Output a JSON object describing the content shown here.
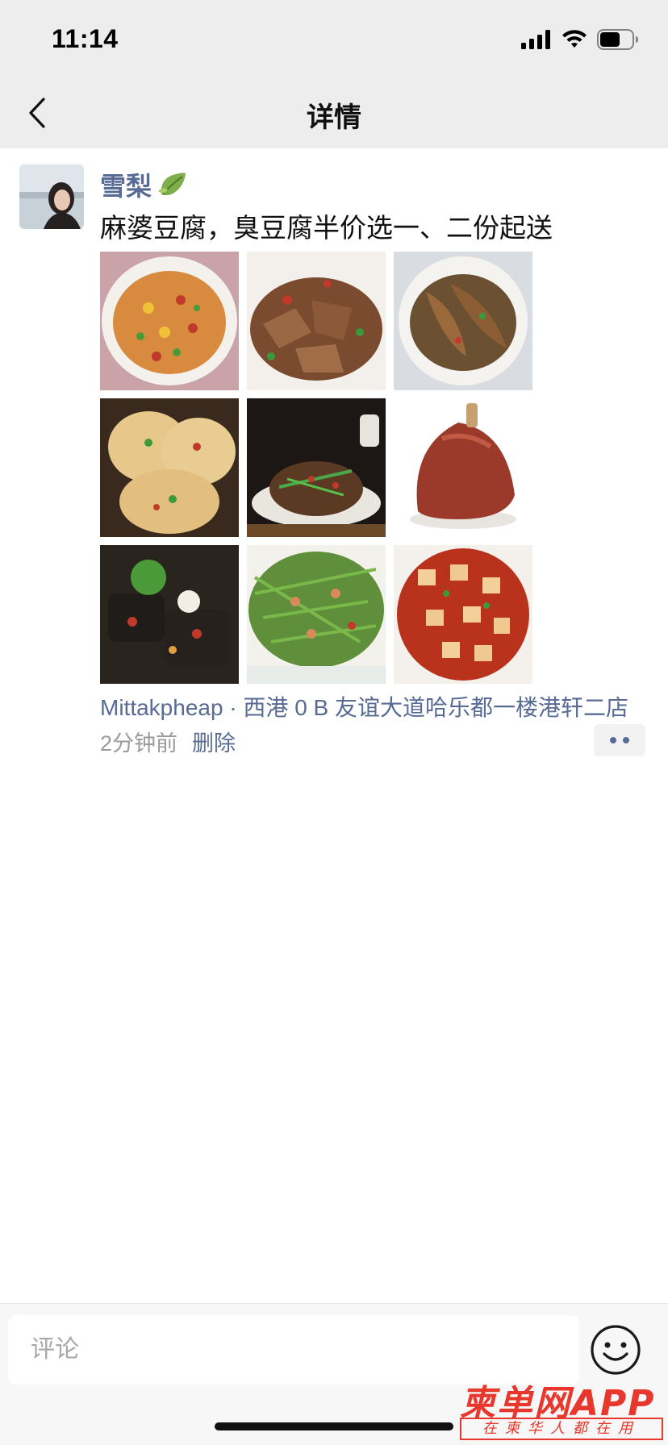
{
  "status_bar": {
    "time": "11:14"
  },
  "nav": {
    "title": "详情"
  },
  "post": {
    "author": "雪梨",
    "text": "麻婆豆腐，臭豆腐半价选一、二份起送",
    "photos": [
      "photo-1",
      "photo-2",
      "photo-3",
      "photo-4",
      "photo-5",
      "photo-6",
      "photo-7",
      "photo-8",
      "photo-9"
    ],
    "location": "Mittakpheap · 西港 0 B 友谊大道哈乐都一楼港轩二店",
    "time_ago": "2分钟前",
    "delete_label": "删除"
  },
  "comment": {
    "placeholder": "评论"
  },
  "watermark": {
    "title": "柬单网APP",
    "subtitle": "在柬华人都在用"
  },
  "colors": {
    "link": "#576b95",
    "bar_bg": "#ededed",
    "watermark": "#e8372c"
  }
}
